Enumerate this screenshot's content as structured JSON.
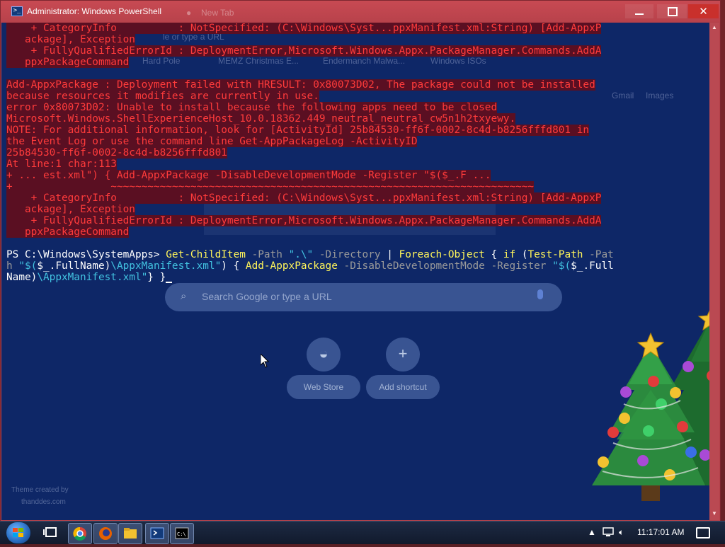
{
  "window": {
    "title": "Administrator: Windows PowerShell",
    "ghost_tab_title": "New Tab",
    "controls": {
      "minimize": "minimize",
      "maximize": "maximize",
      "close": "close"
    }
  },
  "background_chrome": {
    "search_placeholder": "Search Google or type a URL",
    "top_search_hint": "le or type a URL",
    "bookmarks": [
      "Hard Pole",
      "MEMZ Christmas E...",
      "Endermanch Malwa...",
      "Windows ISOs"
    ],
    "links": [
      "Gmail",
      "Images"
    ],
    "shortcuts": [
      "Web Store",
      "Add shortcut"
    ],
    "watermark_line1": "Theme created by",
    "watermark_line2": "thanddes.com"
  },
  "console_lines": [
    {
      "type": "err",
      "text": "    + CategoryInfo          : NotSpecified: (C:\\Windows\\Syst...ppxManifest.xml:String) [Add-AppxP"
    },
    {
      "type": "err",
      "text": "   ackage], Exception"
    },
    {
      "type": "err",
      "text": "    + FullyQualifiedErrorId : DeploymentError,Microsoft.Windows.Appx.PackageManager.Commands.AddA"
    },
    {
      "type": "err",
      "text": "   ppxPackageCommand"
    },
    {
      "type": "blank",
      "text": ""
    },
    {
      "type": "err",
      "text": "Add-AppxPackage : Deployment failed with HRESULT: 0x80073D02, The package could not be installed"
    },
    {
      "type": "err",
      "text": "because resources it modifies are currently in use."
    },
    {
      "type": "err",
      "text": "error 0x80073D02: Unable to install because the following apps need to be closed"
    },
    {
      "type": "err",
      "text": "Microsoft.Windows.ShellExperienceHost_10.0.18362.449_neutral_neutral_cw5n1h2txyewy."
    },
    {
      "type": "err",
      "text": "NOTE: For additional information, look for [ActivityId] 25b84530-ff6f-0002-8c4d-b8256fffd801 in"
    },
    {
      "type": "err",
      "text": "the Event Log or use the command line Get-AppPackageLog -ActivityID"
    },
    {
      "type": "err",
      "text": "25b84530-ff6f-0002-8c4d-b8256fffd801"
    },
    {
      "type": "err",
      "text": "At line:1 char:113"
    },
    {
      "type": "err",
      "text": "+ ... est.xml\") { Add-AppxPackage -DisableDevelopmentMode -Register \"$($_.F ..."
    },
    {
      "type": "err",
      "text": "+                ~~~~~~~~~~~~~~~~~~~~~~~~~~~~~~~~~~~~~~~~~~~~~~~~~~~~~~~~~~~~~~~~~~~~~"
    },
    {
      "type": "err",
      "text": "    + CategoryInfo          : NotSpecified: (C:\\Windows\\Syst...ppxManifest.xml:String) [Add-AppxP"
    },
    {
      "type": "err",
      "text": "   ackage], Exception"
    },
    {
      "type": "err",
      "text": "    + FullyQualifiedErrorId : DeploymentError,Microsoft.Windows.Appx.PackageManager.Commands.AddA"
    },
    {
      "type": "err",
      "text": "   ppxPackageCommand"
    },
    {
      "type": "blank",
      "text": ""
    }
  ],
  "prompt": {
    "line1": [
      {
        "cls": "plain",
        "text": "PS C:\\Windows\\SystemApps> "
      },
      {
        "cls": "cmd",
        "text": "Get-ChildItem"
      },
      {
        "cls": "param",
        "text": " -Path "
      },
      {
        "cls": "str",
        "text": "\".\\\""
      },
      {
        "cls": "param",
        "text": " -Directory"
      },
      {
        "cls": "plain",
        "text": " | "
      },
      {
        "cls": "cmd",
        "text": "Foreach-Object"
      },
      {
        "cls": "plain",
        "text": " { "
      },
      {
        "cls": "cmd",
        "text": "if"
      },
      {
        "cls": "plain",
        "text": " ("
      },
      {
        "cls": "cmd",
        "text": "Test-Path"
      },
      {
        "cls": "param",
        "text": " -Pat"
      }
    ],
    "line2": [
      {
        "cls": "param",
        "text": "h "
      },
      {
        "cls": "str",
        "text": "\"$("
      },
      {
        "cls": "plain",
        "text": "$_"
      },
      {
        "cls": "plain",
        "text": ".FullName)"
      },
      {
        "cls": "str",
        "text": "\\AppxManifest.xml\""
      },
      {
        "cls": "plain",
        "text": ") { "
      },
      {
        "cls": "cmd",
        "text": "Add-AppxPackage"
      },
      {
        "cls": "param",
        "text": " -DisableDevelopmentMode -Register "
      },
      {
        "cls": "str",
        "text": "\"$("
      },
      {
        "cls": "plain",
        "text": "$_"
      },
      {
        "cls": "plain",
        "text": ".Full"
      }
    ],
    "line3": [
      {
        "cls": "plain",
        "text": "Name)"
      },
      {
        "cls": "str",
        "text": "\\AppxManifest.xml\""
      },
      {
        "cls": "plain",
        "text": "} }"
      }
    ]
  },
  "taskbar": {
    "apps": [
      "task-view",
      "chrome",
      "firefox",
      "file-explorer",
      "powershell",
      "cmd"
    ],
    "time": "11:17:01 AM"
  },
  "colors": {
    "console_bg": "#0e2767",
    "error_fg": "#ff3b3b",
    "error_bg": "#5a0f22",
    "titlebar": "#b8424b",
    "cmdlet": "#fff55a",
    "string": "#42c2e0",
    "parameter": "#9a9a9a"
  }
}
